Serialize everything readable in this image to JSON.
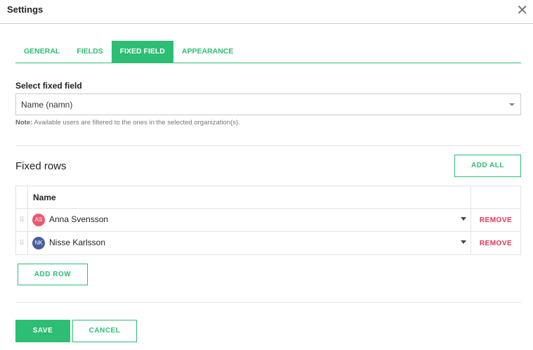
{
  "dialog": {
    "title": "Settings",
    "close_icon": "close-icon"
  },
  "tabs": [
    {
      "label": "GENERAL"
    },
    {
      "label": "FIELDS"
    },
    {
      "label": "FIXED FIELD",
      "active": true
    },
    {
      "label": "APPEARANCE"
    }
  ],
  "fixed_field": {
    "label": "Select fixed field",
    "value": "Name (namn)",
    "note_label": "Note:",
    "note": " Available users are filtered to the ones in the selected organization(s)."
  },
  "fixed_rows": {
    "title": "Fixed rows",
    "add_all": "ADD ALL",
    "column_name": "Name",
    "rows": [
      {
        "initials": "AS",
        "name": "Anna Svensson",
        "color": "#e8596f",
        "remove": "REMOVE"
      },
      {
        "initials": "NK",
        "name": "Nisse Karlsson",
        "color": "#4a5e9e",
        "remove": "REMOVE"
      }
    ],
    "add_row": "ADD ROW"
  },
  "footer": {
    "save": "SAVE",
    "cancel": "CANCEL"
  },
  "colors": {
    "accent": "#2dbd73",
    "danger": "#e8315b"
  }
}
